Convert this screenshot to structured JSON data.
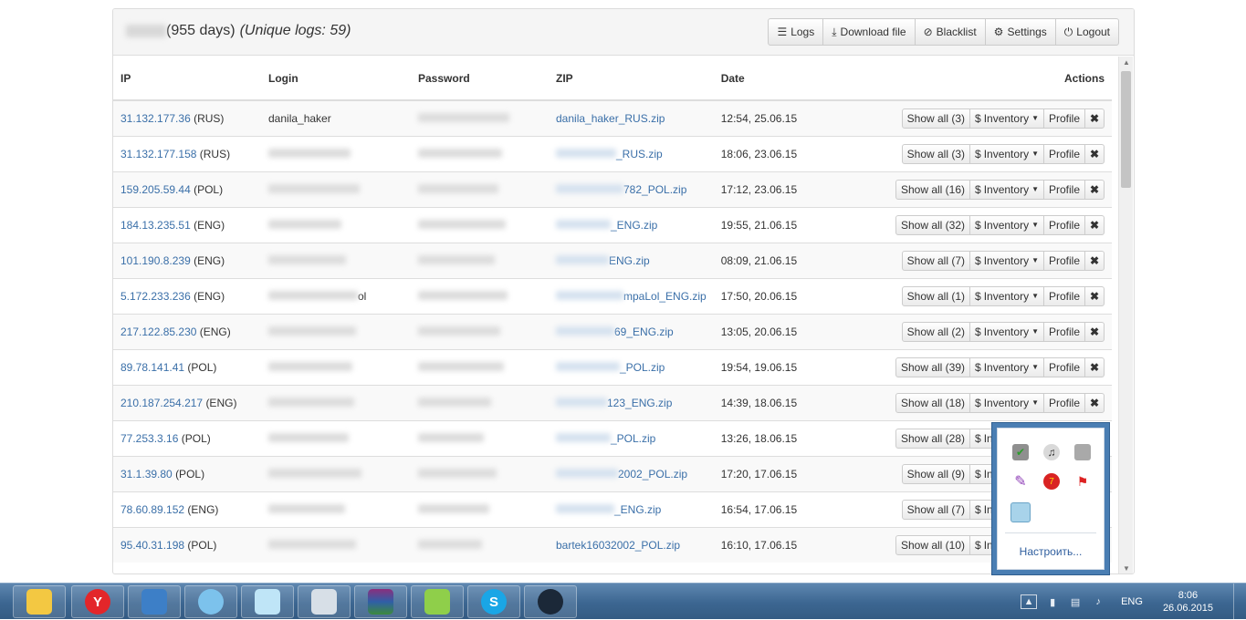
{
  "header": {
    "days_text": "(955 days)",
    "unique_text": "(Unique logs: 59)",
    "buttons": [
      {
        "label": "Logs",
        "icon": "list-icon"
      },
      {
        "label": "Download file",
        "icon": "download-icon"
      },
      {
        "label": "Blacklist",
        "icon": "blacklist-icon"
      },
      {
        "label": "Settings",
        "icon": "gear-icon"
      },
      {
        "label": "Logout",
        "icon": "power-icon"
      }
    ]
  },
  "table": {
    "columns": [
      "IP",
      "Login",
      "Password",
      "ZIP",
      "Date",
      "Actions"
    ],
    "inventory_label": "Inventory",
    "profile_label": "Profile",
    "rows": [
      {
        "ip": "31.132.177.36",
        "country": "(RUS)",
        "login": "danila_haker",
        "zip": "danila_haker_RUS.zip",
        "date": "12:54, 25.06.15",
        "show_all": "Show all (3)"
      },
      {
        "ip": "31.132.177.158",
        "country": "(RUS)",
        "login": "",
        "zip": "_RUS.zip",
        "date": "18:06, 23.06.15",
        "show_all": "Show all (3)"
      },
      {
        "ip": "159.205.59.44",
        "country": "(POL)",
        "login": "",
        "zip": "782_POL.zip",
        "date": "17:12, 23.06.15",
        "show_all": "Show all (16)"
      },
      {
        "ip": "184.13.235.51",
        "country": "(ENG)",
        "login": "",
        "zip": "_ENG.zip",
        "date": "19:55, 21.06.15",
        "show_all": "Show all (32)"
      },
      {
        "ip": "101.190.8.239",
        "country": "(ENG)",
        "login": "",
        "zip": "ENG.zip",
        "date": "08:09, 21.06.15",
        "show_all": "Show all (7)"
      },
      {
        "ip": "5.172.233.236",
        "country": "(ENG)",
        "login": "ol",
        "zip": "mpaLol_ENG.zip",
        "date": "17:50, 20.06.15",
        "show_all": "Show all (1)"
      },
      {
        "ip": "217.122.85.230",
        "country": "(ENG)",
        "login": "",
        "zip": "69_ENG.zip",
        "date": "13:05, 20.06.15",
        "show_all": "Show all (2)"
      },
      {
        "ip": "89.78.141.41",
        "country": "(POL)",
        "login": "",
        "zip": "_POL.zip",
        "date": "19:54, 19.06.15",
        "show_all": "Show all (39)"
      },
      {
        "ip": "210.187.254.217",
        "country": "(ENG)",
        "login": "",
        "zip": "123_ENG.zip",
        "date": "14:39, 18.06.15",
        "show_all": "Show all (18)"
      },
      {
        "ip": "77.253.3.16",
        "country": "(POL)",
        "login": "",
        "zip": "_POL.zip",
        "date": "13:26, 18.06.15",
        "show_all": "Show all (28)"
      },
      {
        "ip": "31.1.39.80",
        "country": "(POL)",
        "login": "",
        "zip": "2002_POL.zip",
        "date": "17:20, 17.06.15",
        "show_all": "Show all (9)"
      },
      {
        "ip": "78.60.89.152",
        "country": "(ENG)",
        "login": "",
        "zip": "_ENG.zip",
        "date": "16:54, 17.06.15",
        "show_all": "Show all (7)"
      },
      {
        "ip": "95.40.31.198",
        "country": "(POL)",
        "login": "",
        "zip": "bartek16032002_POL.zip",
        "date": "16:10, 17.06.15",
        "show_all": "Show all (10)"
      }
    ]
  },
  "tray": {
    "customize_label": "Настроить...",
    "icons": [
      "shield-check-icon",
      "audio-driver-icon",
      "monitor-small-icon",
      "feather-icon",
      "antivirus-badge-icon",
      "flag-error-icon",
      "cube-app-icon"
    ]
  },
  "taskbar": {
    "apps": [
      "file-explorer-icon",
      "yandex-browser-icon",
      "remote-desktop-icon",
      "messenger-icon",
      "notepad-icon",
      "task-manager-icon",
      "winrar-icon",
      "notepad-plus-icon",
      "skype-icon",
      "steam-icon"
    ],
    "skype_letter": "S",
    "yandex_letter": "Y",
    "lang": "ENG",
    "time": "8:06",
    "date": "26.06.2015"
  }
}
